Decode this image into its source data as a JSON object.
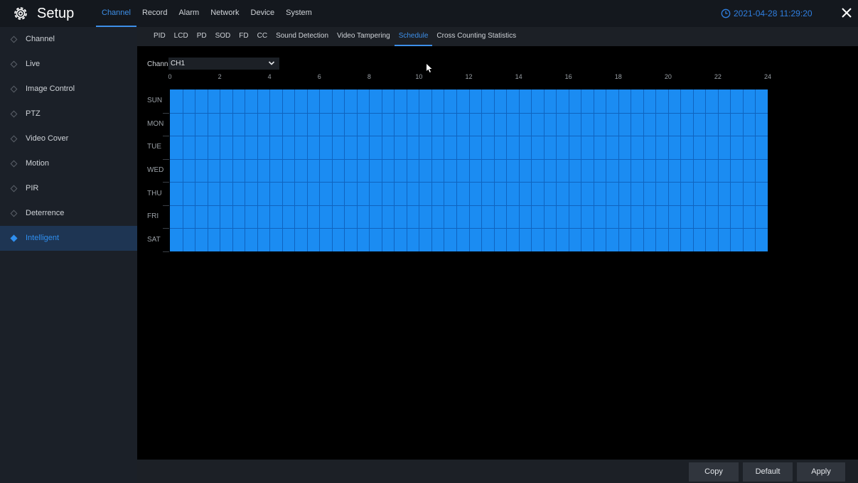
{
  "header": {
    "title": "Setup",
    "logo_icon": "gear-icon",
    "datetime": "2021-04-28 11:29:20",
    "clock_icon": "clock-icon",
    "close_icon": "close-icon",
    "accent_color": "#2f7fe0"
  },
  "topnav": [
    {
      "label": "Channel",
      "active": true
    },
    {
      "label": "Record",
      "active": false
    },
    {
      "label": "Alarm",
      "active": false
    },
    {
      "label": "Network",
      "active": false
    },
    {
      "label": "Device",
      "active": false
    },
    {
      "label": "System",
      "active": false
    }
  ],
  "sidebar": {
    "items": [
      {
        "label": "Channel",
        "active": false
      },
      {
        "label": "Live",
        "active": false
      },
      {
        "label": "Image Control",
        "active": false
      },
      {
        "label": "PTZ",
        "active": false
      },
      {
        "label": "Video Cover",
        "active": false
      },
      {
        "label": "Motion",
        "active": false
      },
      {
        "label": "PIR",
        "active": false
      },
      {
        "label": "Deterrence",
        "active": false
      },
      {
        "label": "Intelligent",
        "active": true
      }
    ]
  },
  "subtabs": [
    {
      "label": "PID",
      "active": false
    },
    {
      "label": "LCD",
      "active": false
    },
    {
      "label": "PD",
      "active": false
    },
    {
      "label": "SOD",
      "active": false
    },
    {
      "label": "FD",
      "active": false
    },
    {
      "label": "CC",
      "active": false
    },
    {
      "label": "Sound Detection",
      "active": false
    },
    {
      "label": "Video Tampering",
      "active": false
    },
    {
      "label": "Schedule",
      "active": true
    },
    {
      "label": "Cross Counting Statistics",
      "active": false
    }
  ],
  "schedule": {
    "channel_label": "Channel",
    "channel_value": "CH1",
    "hour_labels": [
      "0",
      "2",
      "4",
      "6",
      "8",
      "10",
      "12",
      "14",
      "16",
      "18",
      "20",
      "22",
      "24"
    ],
    "days": [
      "SUN",
      "MON",
      "TUE",
      "WED",
      "THU",
      "FRI",
      "SAT"
    ],
    "all_slots_selected": true,
    "selected_color": "#1b8cf2"
  },
  "footer": {
    "copy_label": "Copy",
    "default_label": "Default",
    "apply_label": "Apply"
  }
}
